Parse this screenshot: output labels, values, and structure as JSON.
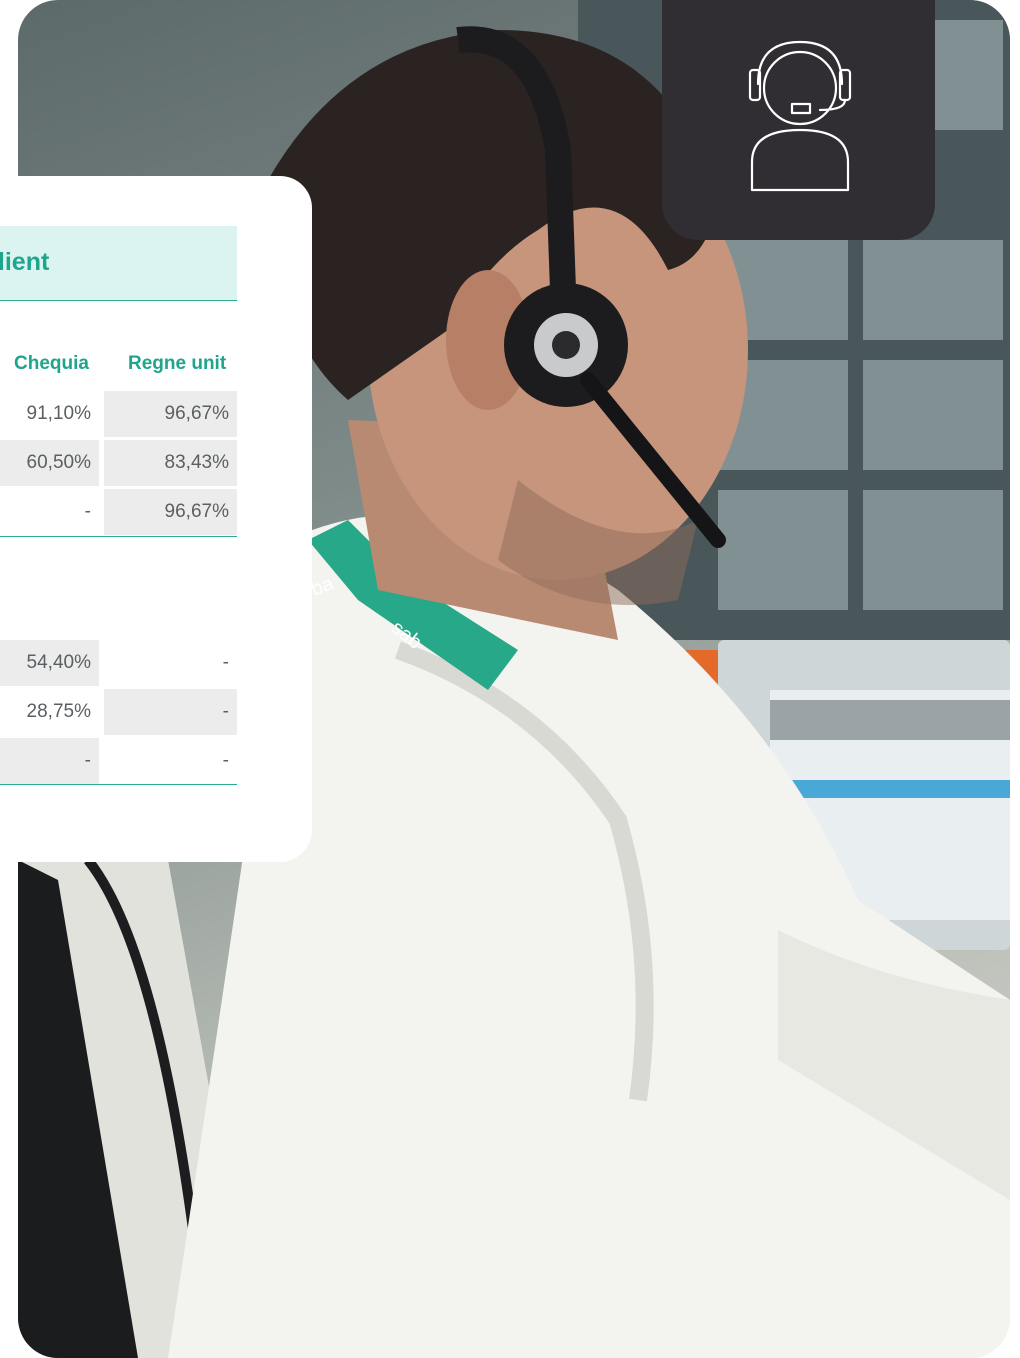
{
  "table": {
    "title": "client",
    "columns": [
      "Chequia",
      "Regne unit"
    ],
    "section1": [
      [
        "91,10%",
        "96,67%"
      ],
      [
        "60,50%",
        "83,43%"
      ],
      [
        "-",
        "96,67%"
      ]
    ],
    "section2": [
      [
        "54,40%",
        "-"
      ],
      [
        "28,75%",
        "-"
      ],
      [
        "-",
        "-"
      ]
    ]
  },
  "photo": {
    "lanyard_text_1": "ba",
    "lanyard_text_2": "sab"
  },
  "colors": {
    "accent": "#1ea58c",
    "title_bg": "#dcf4f1",
    "badge_bg": "#302d33",
    "row_shade": "#ececec"
  },
  "icons": {
    "badge": "headset-agent-icon"
  }
}
